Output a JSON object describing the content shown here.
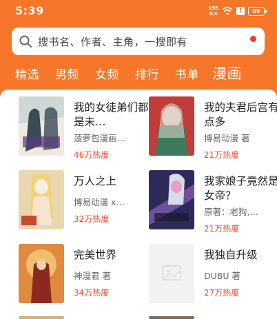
{
  "status_bar": {
    "time": "5:39",
    "net_speed_value": "195",
    "net_speed_unit": "K/s",
    "alert": "!",
    "battery": "69"
  },
  "search": {
    "placeholder": "搜书名、作者、主角，一搜即有"
  },
  "tabs": [
    {
      "label": "精选"
    },
    {
      "label": "男频"
    },
    {
      "label": "女频"
    },
    {
      "label": "排行"
    },
    {
      "label": "书单"
    },
    {
      "label": "漫画",
      "active": true
    }
  ],
  "books": [
    {
      "title": "我的女徒弟们都是未…",
      "author": "菠萝包漫画…",
      "heat": "46万热度",
      "cover_colors": [
        "#cfd8d6",
        "#3a4a56",
        "#f2e8e0"
      ]
    },
    {
      "title": "我的夫君后宫有点多",
      "author": "博易动漫 著",
      "heat": "21万热度",
      "cover_colors": [
        "#c03d3a",
        "#3e7a5c",
        "#f0d8c8"
      ]
    },
    {
      "title": "万人之上",
      "author": "博易动漫 x…",
      "heat": "32万热度",
      "cover_colors": [
        "#e9d7b0",
        "#c44a32",
        "#f7efe0"
      ]
    },
    {
      "title": "我家娘子竟然是女帝？",
      "author": "原著：老狗,…",
      "heat": "21万热度",
      "cover_colors": [
        "#2e2a5a",
        "#7d5bb0",
        "#e8a0c0"
      ]
    },
    {
      "title": "完美世界",
      "author": "神漫君 著",
      "heat": "34万热度",
      "cover_colors": [
        "#e08a40",
        "#8a2a1e",
        "#f6cc7a"
      ]
    },
    {
      "title": "我独自升级",
      "author": "DUBU 著",
      "heat": "27万热度",
      "cover_colors": [
        "#f2f2f2",
        "#dedede",
        "#ebebeb"
      ]
    }
  ],
  "colors": {
    "accent": "#f7772a",
    "heat": "#f2492f"
  }
}
